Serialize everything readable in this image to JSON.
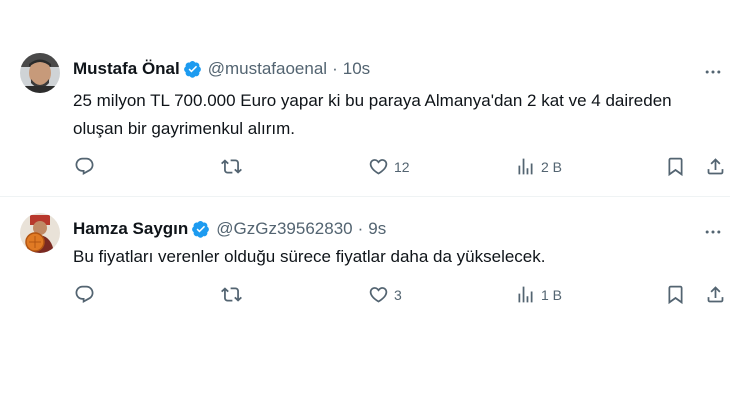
{
  "tweets": [
    {
      "name": "Mustafa Önal",
      "handle": "@mustafaoenal",
      "time": "10s",
      "text": "25 milyon TL 700.000 Euro yapar ki bu paraya Almanya'dan 2 kat ve 4 daireden oluşan bir gayrimenkul alırım.",
      "replies": "",
      "retweets": "",
      "likes": "12",
      "views": "2 B"
    },
    {
      "name": "Hamza Saygın",
      "handle": "@GzGz39562830",
      "time": "9s",
      "text": "Bu fiyatları verenler olduğu sürece fiyatlar daha da yükselecek.",
      "replies": "",
      "retweets": "",
      "likes": "3",
      "views": "1 B"
    }
  ],
  "separator": "·",
  "colors": {
    "verified": "#1d9bf0",
    "muted": "#536471",
    "text": "#0f1419",
    "divider": "#eff3f4"
  },
  "icons": [
    "verified-badge-icon",
    "more-icon",
    "reply-icon",
    "retweet-icon",
    "like-icon",
    "views-icon",
    "bookmark-icon",
    "share-icon"
  ]
}
